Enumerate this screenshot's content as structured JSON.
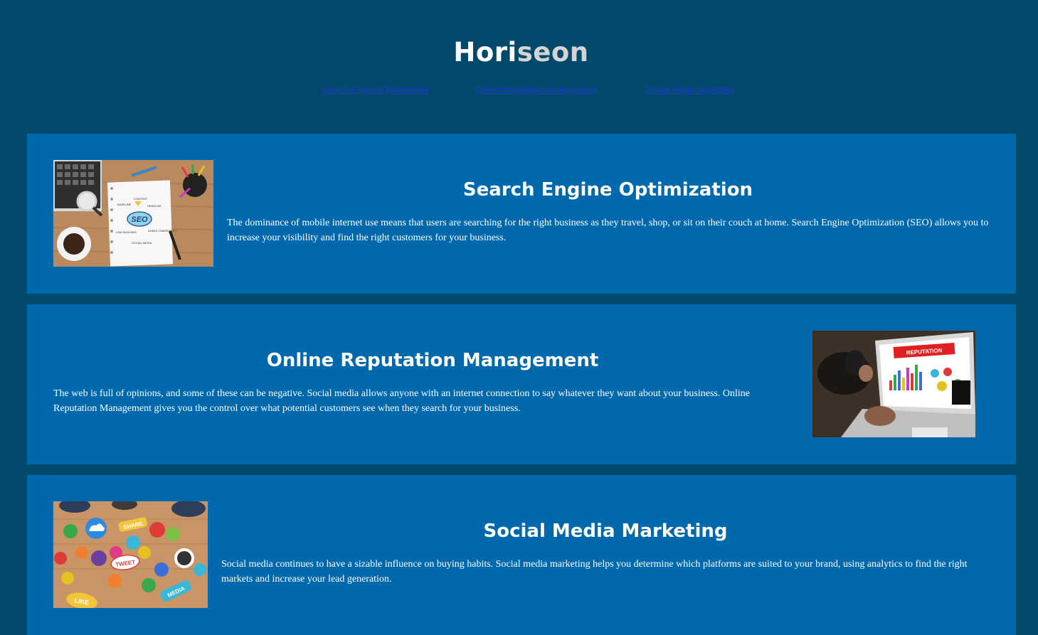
{
  "header": {
    "logo_part1": "Hori",
    "logo_part2": "seon",
    "nav": [
      {
        "label": "Search Engine Optimization"
      },
      {
        "label": "Online Reputation Management"
      },
      {
        "label": "Social Media Marketing"
      }
    ]
  },
  "sections": [
    {
      "title": "Search Engine Optimization",
      "body": "The dominance of mobile internet use means that users are searching for the right business as they travel, shop, or sit on their couch at home. Search Engine Optimization (SEO) allows you to increase your visibility and find the right customers for your business.",
      "image_labels": [
        "SEO",
        "CONTENT",
        "HEADLINE",
        "BASELINE",
        "LINK BUILDING",
        "MOBILE COMPATIBILITY",
        "SOCIAL MEDIA"
      ]
    },
    {
      "title": "Online Reputation Management",
      "body": "The web is full of opinions, and some of these can be negative. Social media allows anyone with an internet connection to say whatever they want about your business. Online Reputation Management gives you the control over what potential customers see when they search for your business.",
      "image_labels": [
        "REPUTATION"
      ]
    },
    {
      "title": "Social Media Marketing",
      "body": "Social media continues to have a sizable influence on buying habits. Social media marketing helps you determine which platforms are suited to your brand, using analytics to find the right markets and increase your lead generation.",
      "image_labels": [
        "SHARE",
        "TWEET",
        "LIKE",
        "MEDIA"
      ]
    }
  ],
  "colors": {
    "page_bg": "#024a6c",
    "card_bg": "#0069ae",
    "nav_link": "#1f39c9",
    "logo_white": "#ffffff",
    "logo_grey": "#d4d4d4"
  }
}
